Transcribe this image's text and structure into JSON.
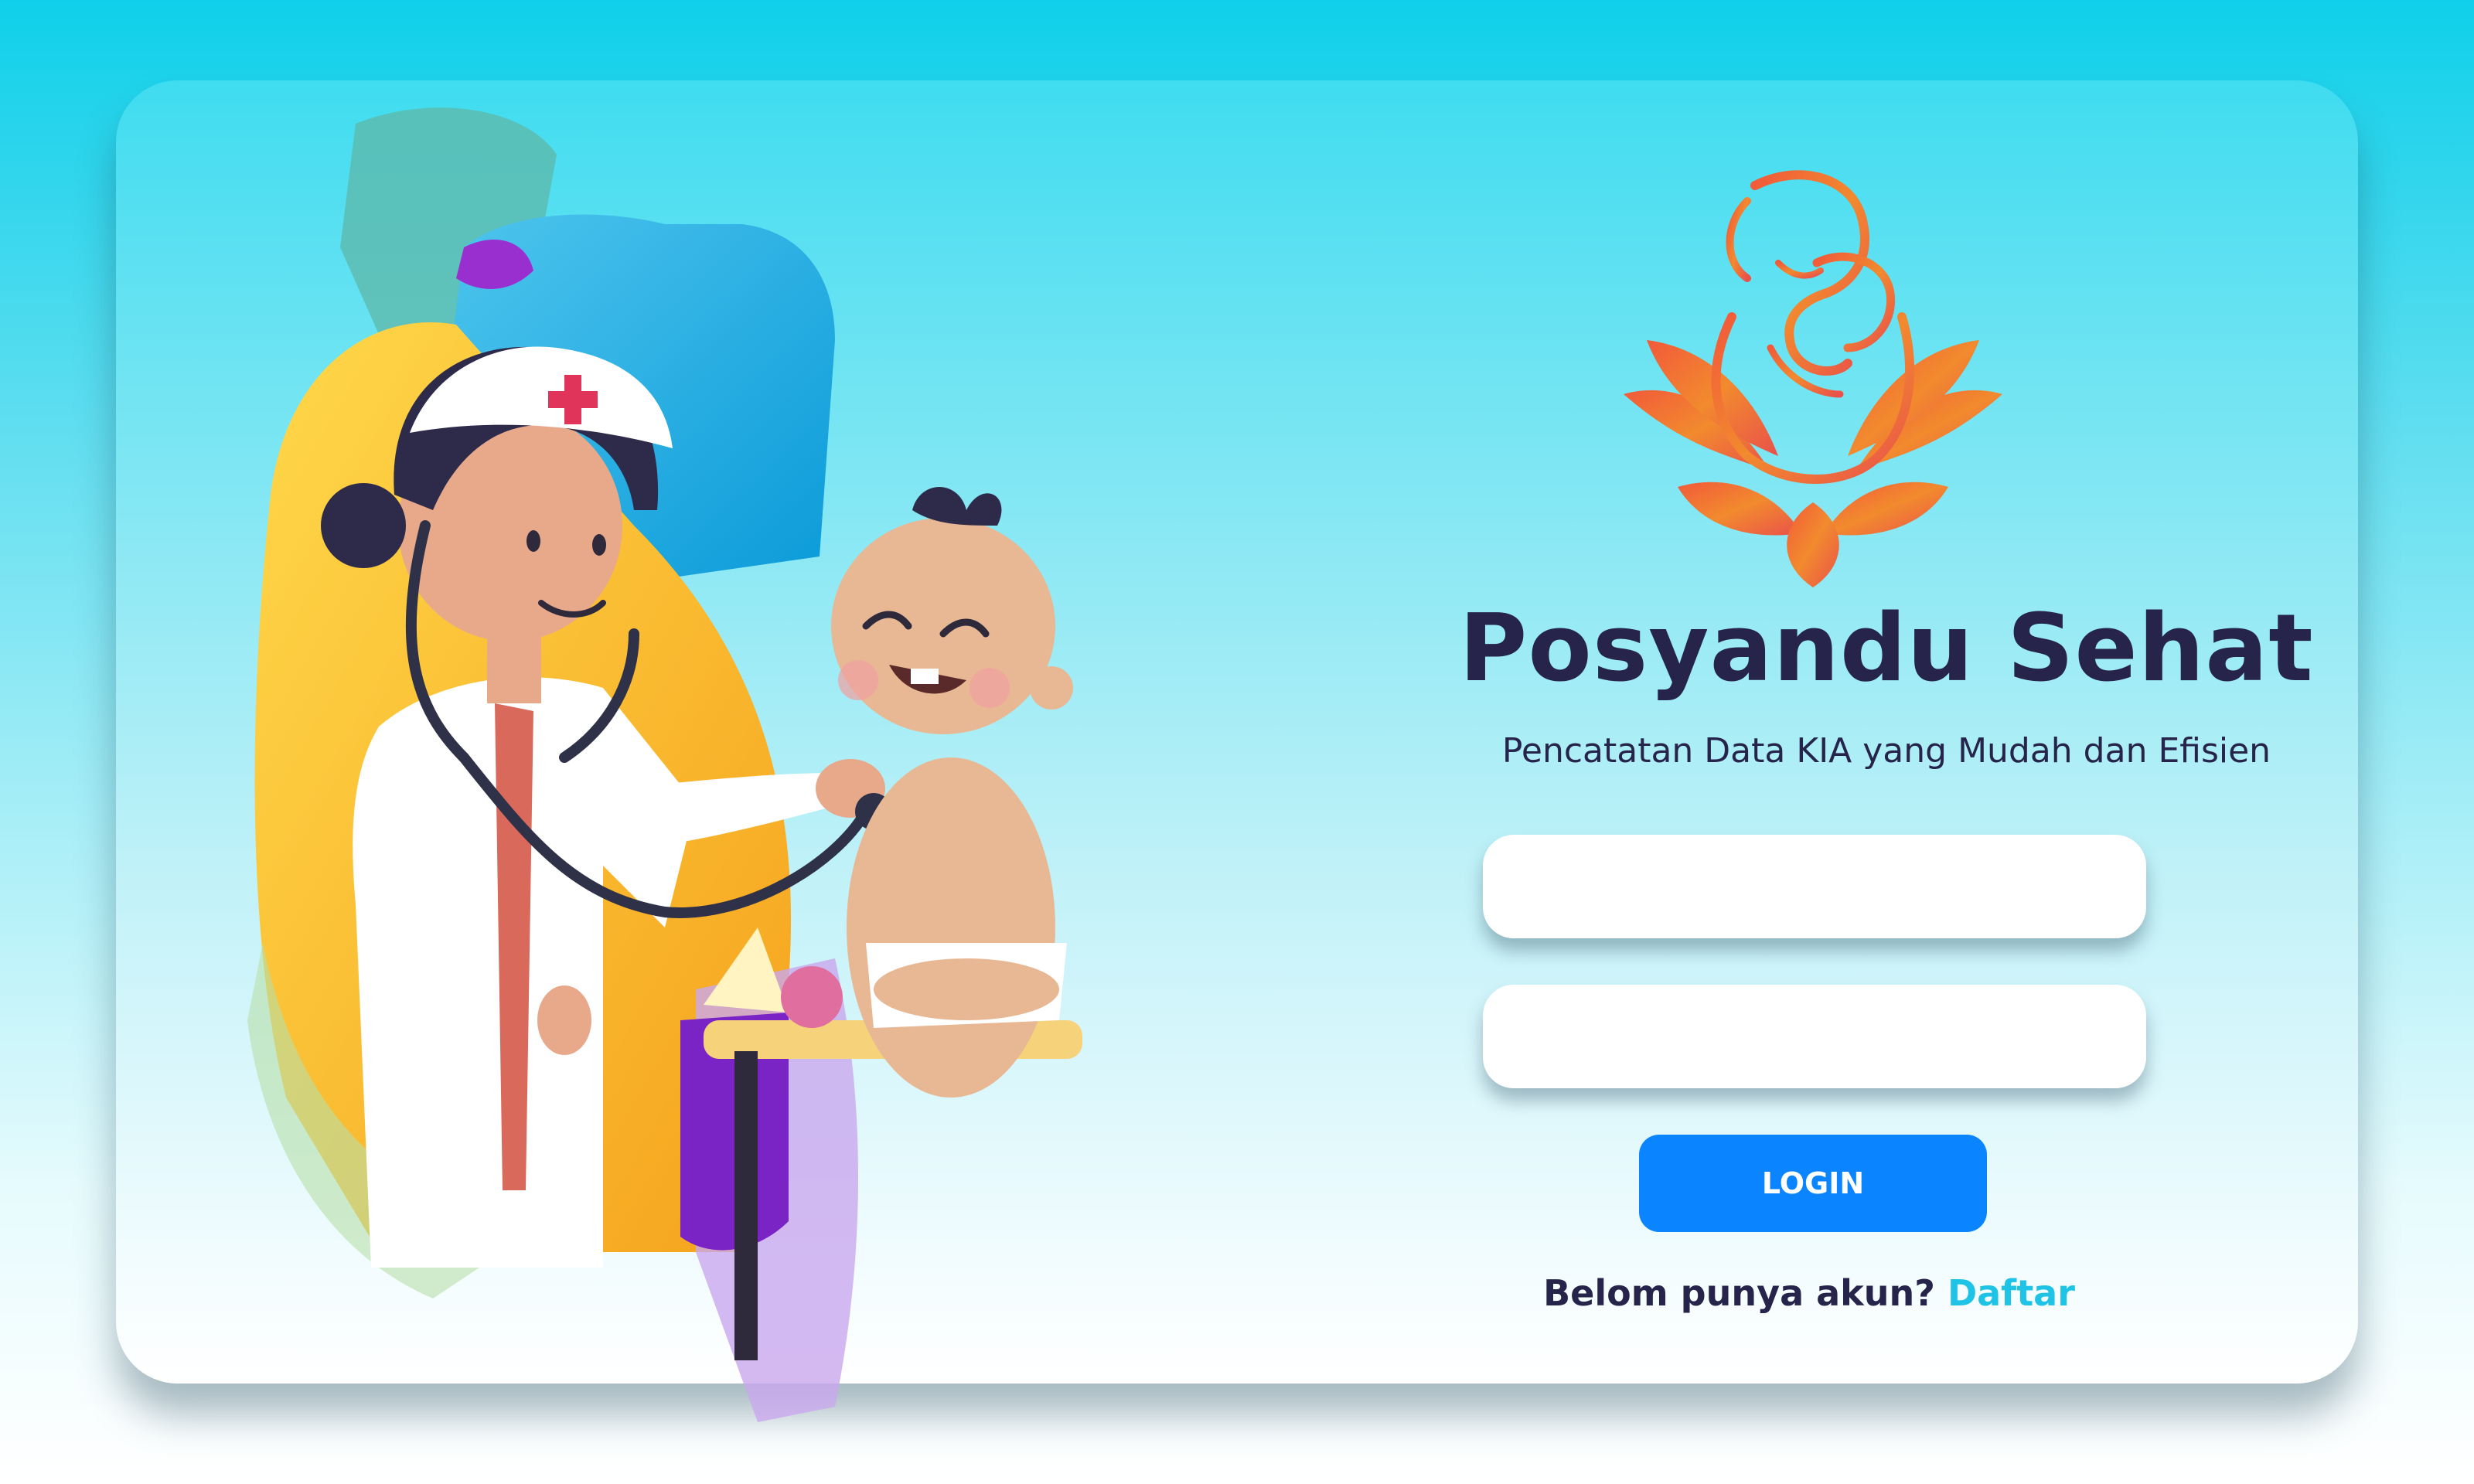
{
  "brand": {
    "title": "Posyandu Sehat",
    "subtitle": "Pencatatan Data KIA yang Mudah dan Efisien"
  },
  "form": {
    "username_placeholder": "",
    "password_placeholder": "",
    "login_label": "LOGIN"
  },
  "register": {
    "prompt": "Belom punya akun?",
    "link_label": "Daftar"
  },
  "icons": {
    "logo": "mother-child-lotus-logo",
    "illustration": "nurse-examining-baby-illustration"
  },
  "colors": {
    "accent": "#0a85ff",
    "link": "#1ec3e6",
    "text_dark": "#26244a",
    "logo_orange": "#f0742e"
  }
}
